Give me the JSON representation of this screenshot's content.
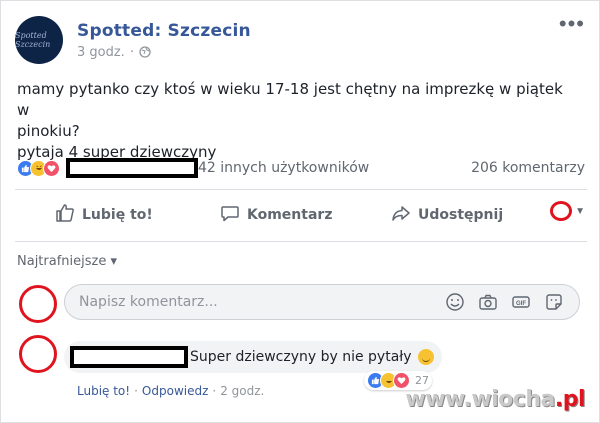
{
  "post": {
    "page_name": "Spotted: Szczecin",
    "time": "3 godz.",
    "avatar_label": "Spotted Szczecin",
    "more_label": "•••",
    "text_line1": "mamy pytanko czy ktoś w wieku 17-18 jest chętny na imprezkę w piątek w",
    "text_line2": "pinokiu?",
    "text_line3": "pytaja 4 super dziewczyny"
  },
  "stats": {
    "others": "42 innych użytkowników",
    "comments": "206 komentarzy",
    "reaction_icons": [
      "like-icon",
      "haha-icon",
      "love-icon"
    ]
  },
  "actions": {
    "like": "Lubię to!",
    "comment": "Komentarz",
    "share": "Udostępnij"
  },
  "comments_section": {
    "sort": "Najtrafniejsze ▾",
    "composer_placeholder": "Napisz komentarz...",
    "composer_icons": [
      "emoji-icon",
      "camera-icon",
      "gif-icon",
      "sticker-icon"
    ]
  },
  "comment": {
    "text": "Super dziewczyny by nie pytały",
    "reaction_count": "27",
    "like": "Lubię to!",
    "reply": "Odpowiedz",
    "time": "2 godz."
  },
  "watermark": {
    "text_prefix": "www.wiocha",
    "text_suffix": ".pl"
  },
  "colors": {
    "link_blue": "#365899",
    "annotation_red": "#e0141e",
    "like_blue": "#3b7bf0",
    "love_red": "#f25268"
  }
}
